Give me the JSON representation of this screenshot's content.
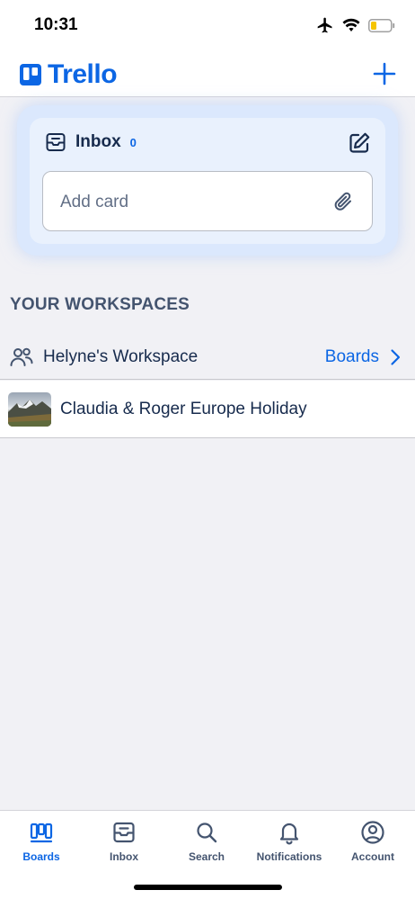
{
  "status_bar": {
    "time": "10:31"
  },
  "header": {
    "app_name": "Trello"
  },
  "inbox": {
    "title": "Inbox",
    "count": "0",
    "add_card_placeholder": "Add card"
  },
  "workspaces": {
    "section_title": "YOUR WORKSPACES",
    "items": [
      {
        "name": "Helyne's Workspace",
        "boards_link": "Boards",
        "boards": [
          {
            "name": "Claudia & Roger Europe Holiday"
          }
        ]
      }
    ]
  },
  "tab_bar": {
    "tabs": [
      {
        "label": "Boards",
        "icon": "boards-icon",
        "active": true
      },
      {
        "label": "Inbox",
        "icon": "inbox-icon",
        "active": false
      },
      {
        "label": "Search",
        "icon": "search-icon",
        "active": false
      },
      {
        "label": "Notifications",
        "icon": "bell-icon",
        "active": false
      },
      {
        "label": "Account",
        "icon": "account-icon",
        "active": false
      }
    ]
  },
  "colors": {
    "brand_blue": "#0c66e4",
    "text_primary": "#172b4d",
    "text_secondary": "#44546f",
    "background": "#f1f1f5",
    "inbox_glow": "#dbe8fd"
  }
}
